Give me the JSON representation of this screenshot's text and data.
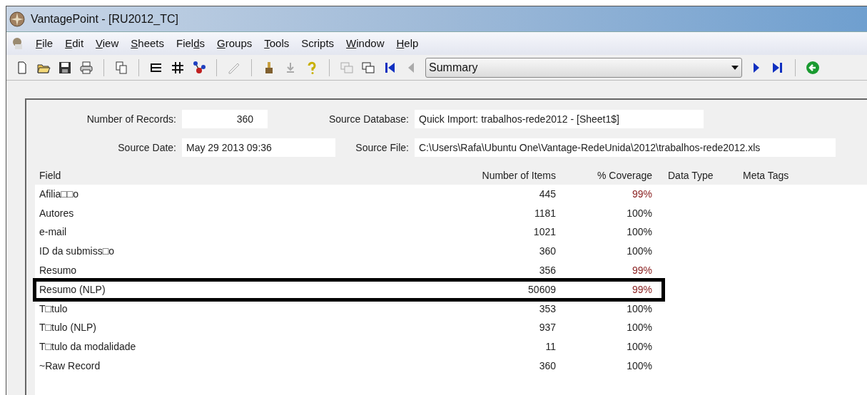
{
  "window": {
    "title": "VantagePoint - [RU2012_TC]"
  },
  "menu": [
    {
      "key": "F",
      "after": "ile"
    },
    {
      "key": "E",
      "after": "dit"
    },
    {
      "key": "V",
      "after": "iew"
    },
    {
      "key": "S",
      "after": "heets"
    },
    {
      "before": "Fiel",
      "key": "d",
      "after": "s"
    },
    {
      "key": "G",
      "after": "roups"
    },
    {
      "key": "T",
      "after": "ools"
    },
    {
      "before": "Scripts"
    },
    {
      "key": "W",
      "after": "indow"
    },
    {
      "key": "H",
      "after": "elp"
    }
  ],
  "toolbar": {
    "view_select": "Summary"
  },
  "summary": {
    "records_label": "Number of Records:",
    "records": "360",
    "database_label": "Source Database:",
    "database": "Quick Import: trabalhos-rede2012 - [Sheet1$]",
    "date_label": "Source Date:",
    "date": "May 29 2013 09:36",
    "file_label": "Source File:",
    "file": "C:\\Users\\Rafa\\Ubuntu One\\Vantage-RedeUnida\\2012\\trabalhos-rede2012.xls"
  },
  "table": {
    "columns": [
      "Field",
      "Number of Items",
      "% Coverage",
      "Data Type",
      "Meta Tags"
    ],
    "rows": [
      {
        "field": "Afilia□□o",
        "items": "445",
        "coverage": "99%",
        "color": "#8b2323",
        "highlighted": false
      },
      {
        "field": "Autores",
        "items": "1181",
        "coverage": "100%",
        "color": "#222222",
        "highlighted": false
      },
      {
        "field": "e-mail",
        "items": "1021",
        "coverage": "100%",
        "color": "#222222",
        "highlighted": false
      },
      {
        "field": "ID da submiss□o",
        "items": "360",
        "coverage": "100%",
        "color": "#222222",
        "highlighted": false
      },
      {
        "field": "Resumo",
        "items": "356",
        "coverage": "99%",
        "color": "#8b2323",
        "highlighted": false
      },
      {
        "field": "Resumo (NLP)",
        "items": "50609",
        "coverage": "99%",
        "color": "#8b2323",
        "highlighted": true
      },
      {
        "field": "T□tulo",
        "items": "353",
        "coverage": "100%",
        "color": "#222222",
        "highlighted": false
      },
      {
        "field": "T□tulo (NLP)",
        "items": "937",
        "coverage": "100%",
        "color": "#222222",
        "highlighted": false
      },
      {
        "field": "T□tulo da modalidade",
        "items": "11",
        "coverage": "100%",
        "color": "#222222",
        "highlighted": false
      },
      {
        "field": "~Raw Record",
        "items": "360",
        "coverage": "100%",
        "color": "#222222",
        "highlighted": false
      }
    ]
  }
}
